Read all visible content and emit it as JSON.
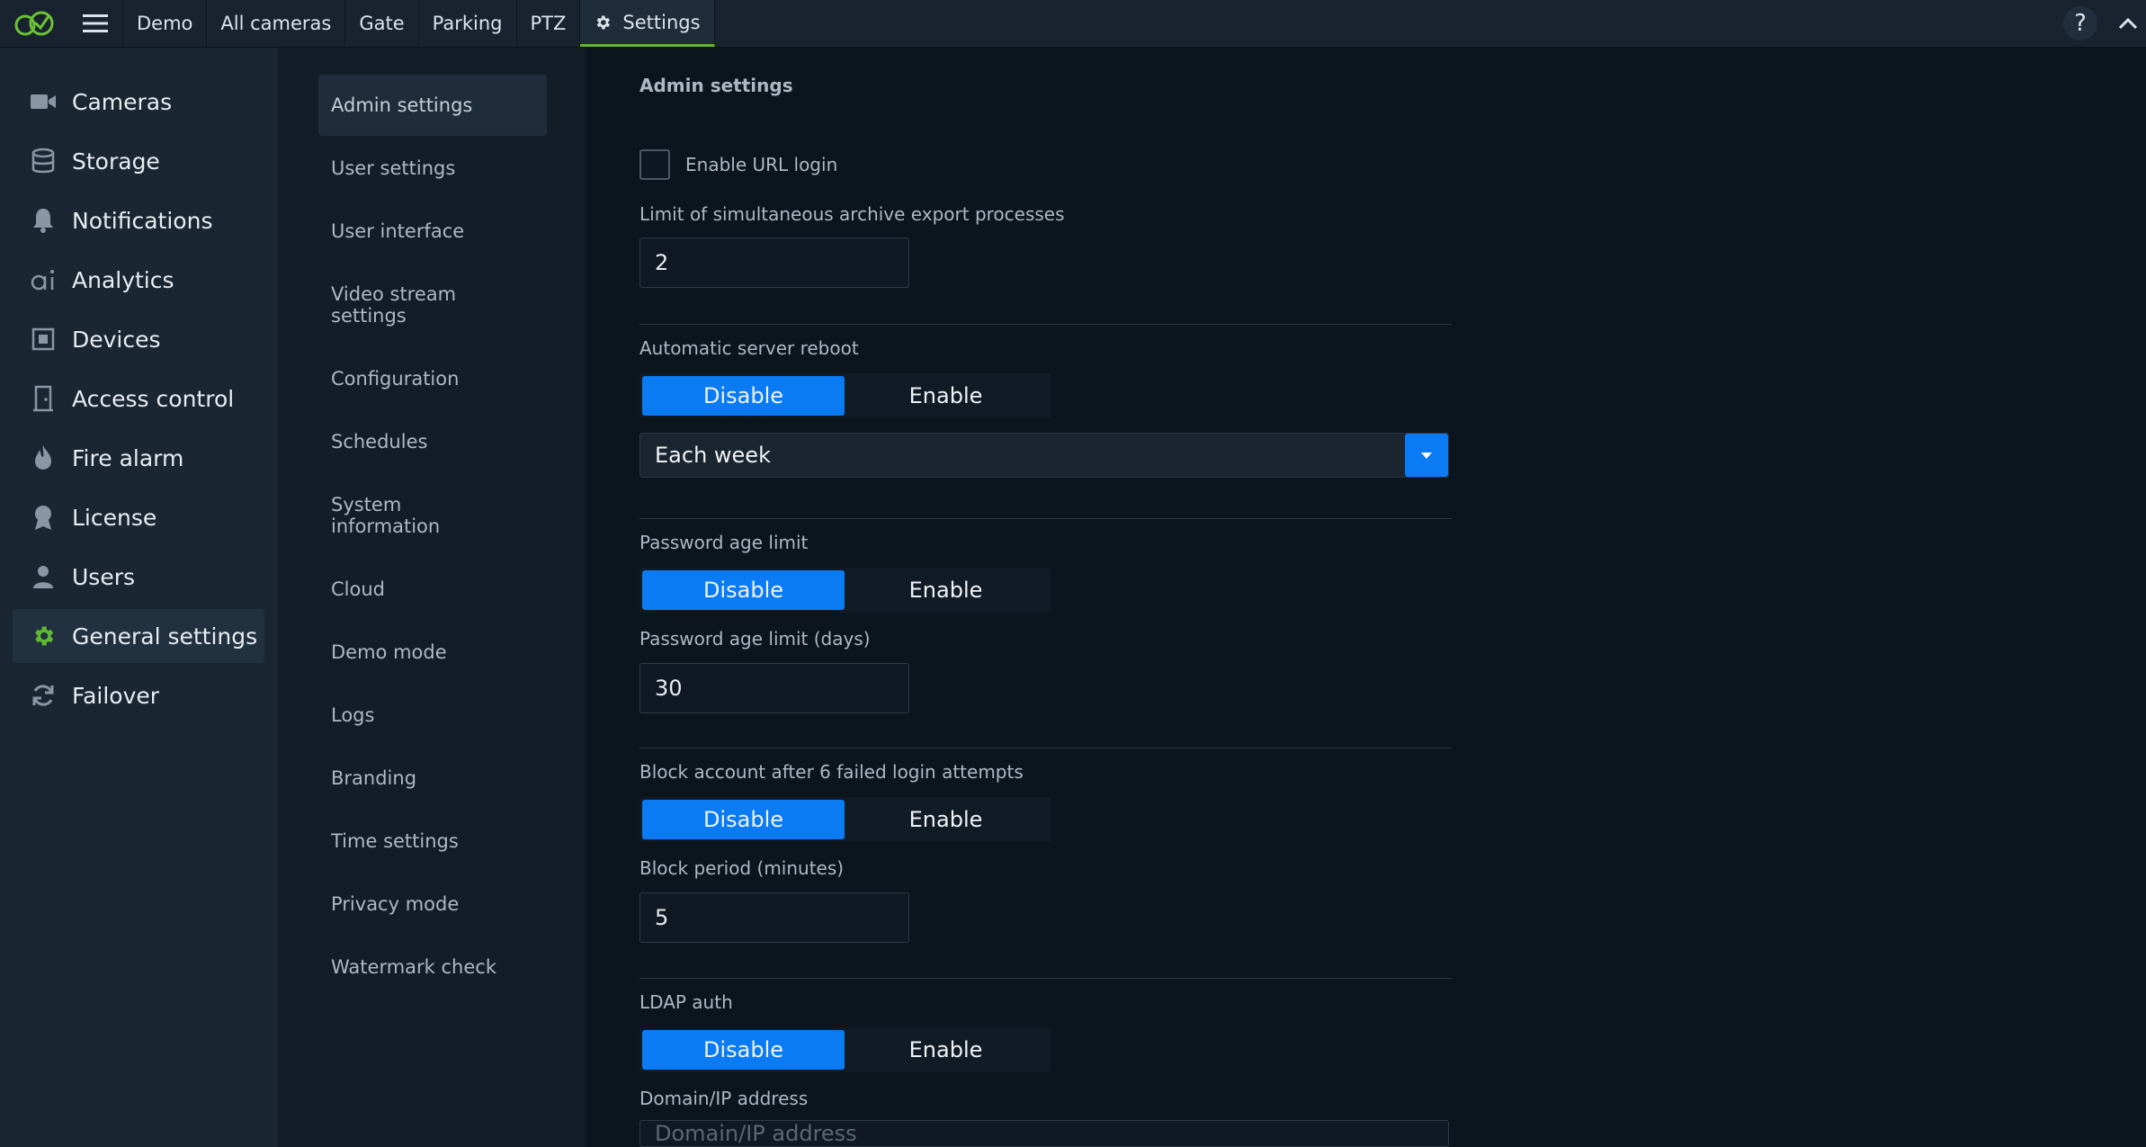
{
  "topbar": {
    "tabs": [
      {
        "label": "Demo"
      },
      {
        "label": "All cameras"
      },
      {
        "label": "Gate"
      },
      {
        "label": "Parking"
      },
      {
        "label": "PTZ"
      },
      {
        "label": "Settings",
        "active": true
      }
    ],
    "help_label": "?"
  },
  "sidebar": {
    "items": [
      {
        "label": "Cameras",
        "icon": "camera-icon"
      },
      {
        "label": "Storage",
        "icon": "database-icon"
      },
      {
        "label": "Notifications",
        "icon": "bell-icon"
      },
      {
        "label": "Analytics",
        "icon": "ai-icon"
      },
      {
        "label": "Devices",
        "icon": "device-icon"
      },
      {
        "label": "Access control",
        "icon": "door-icon"
      },
      {
        "label": "Fire alarm",
        "icon": "flame-icon"
      },
      {
        "label": "License",
        "icon": "award-icon"
      },
      {
        "label": "Users",
        "icon": "user-icon"
      },
      {
        "label": "General settings",
        "icon": "gear-icon",
        "active": true
      },
      {
        "label": "Failover",
        "icon": "sync-icon"
      }
    ]
  },
  "submenu": {
    "items": [
      {
        "label": "Admin settings",
        "active": true
      },
      {
        "label": "User settings"
      },
      {
        "label": "User interface"
      },
      {
        "label": "Video stream settings"
      },
      {
        "label": "Configuration"
      },
      {
        "label": "Schedules"
      },
      {
        "label": "System information"
      },
      {
        "label": "Cloud"
      },
      {
        "label": "Demo mode"
      },
      {
        "label": "Logs"
      },
      {
        "label": "Branding"
      },
      {
        "label": "Time settings"
      },
      {
        "label": "Privacy mode"
      },
      {
        "label": "Watermark check"
      }
    ]
  },
  "main": {
    "title": "Admin settings",
    "url_login": {
      "label": "Enable URL login",
      "checked": false
    },
    "export_limit": {
      "label": "Limit of simultaneous archive export processes",
      "value": "2"
    },
    "server_reboot": {
      "label": "Automatic server reboot",
      "disable": "Disable",
      "enable": "Enable",
      "selected": "Disable",
      "schedule": "Each week"
    },
    "password_age": {
      "label": "Password age limit",
      "disable": "Disable",
      "enable": "Enable",
      "selected": "Disable",
      "days_label": "Password age limit (days)",
      "days_value": "30"
    },
    "block_account": {
      "label": "Block account after 6 failed login attempts",
      "disable": "Disable",
      "enable": "Enable",
      "selected": "Disable",
      "period_label": "Block period (minutes)",
      "period_value": "5"
    },
    "ldap": {
      "label": "LDAP auth",
      "disable": "Disable",
      "enable": "Enable",
      "selected": "Disable",
      "domain_label": "Domain/IP address",
      "domain_placeholder": "Domain/IP address"
    }
  },
  "colors": {
    "accent": "#0a7bf2",
    "brand_green": "#5fb832",
    "background": "#0c141e"
  }
}
